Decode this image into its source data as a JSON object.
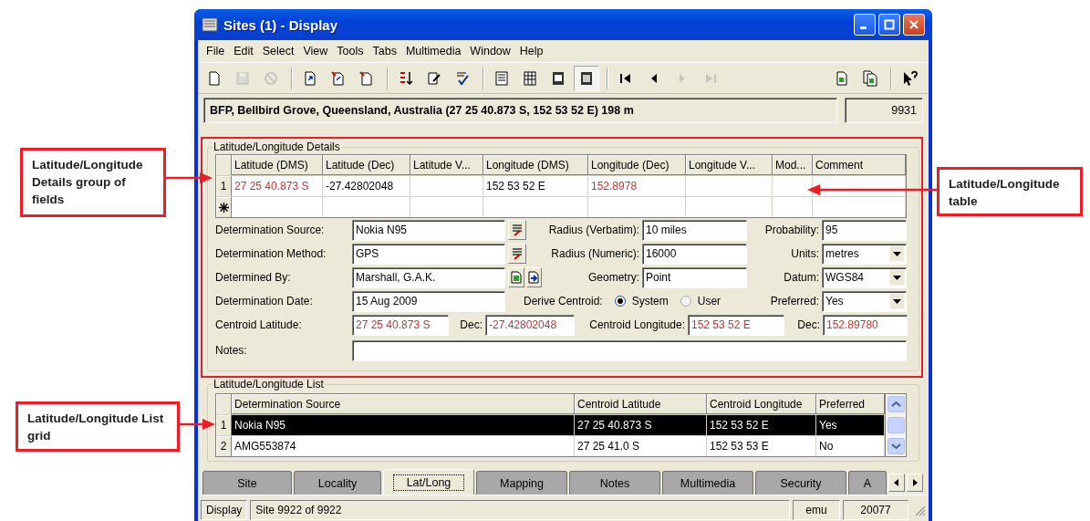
{
  "window": {
    "title": "Sites (1) - Display"
  },
  "menu": [
    "File",
    "Edit",
    "Select",
    "View",
    "Tools",
    "Tabs",
    "Multimedia",
    "Window",
    "Help"
  ],
  "toolbar": [
    {
      "disabled": false,
      "pressed": false
    },
    {
      "disabled": true,
      "pressed": false
    },
    {
      "disabled": true,
      "pressed": false
    },
    {
      "disabled": false,
      "pressed": false
    },
    {
      "disabled": false,
      "pressed": false
    },
    {
      "disabled": false,
      "pressed": false
    },
    {
      "disabled": false,
      "pressed": false
    },
    {
      "disabled": false,
      "pressed": false
    },
    {
      "disabled": false,
      "pressed": false
    },
    {
      "disabled": false,
      "pressed": false
    },
    {
      "disabled": false,
      "pressed": false
    },
    {
      "disabled": false,
      "pressed": false
    },
    {
      "disabled": false,
      "pressed": true
    },
    {
      "disabled": false,
      "pressed": false
    },
    {
      "disabled": false,
      "pressed": false
    },
    {
      "disabled": true,
      "pressed": false
    },
    {
      "disabled": true,
      "pressed": false
    },
    {
      "disabled": false,
      "pressed": false
    },
    {
      "disabled": false,
      "pressed": false
    },
    {
      "disabled": false,
      "pressed": false
    }
  ],
  "record_bar": {
    "summary": "BFP, Bellbird Grove, Queensland, Australia (27 25 40.873 S, 152 53 52 E) 198 m",
    "number": "9931"
  },
  "details": {
    "title": "Latitude/Longitude Details",
    "table": {
      "columns": [
        "Latitude (DMS)",
        "Latitude (Dec)",
        "Latitude V...",
        "Longitude (DMS)",
        "Longitude (Dec)",
        "Longitude V...",
        "Mod...",
        "Comment"
      ],
      "rows": [
        {
          "kind": "data",
          "number": "1",
          "cells": [
            {
              "text": "27 25 40.873 S",
              "color": "#c83232"
            },
            {
              "text": "-27.42802048",
              "color": "#000000"
            },
            null,
            {
              "text": "152 53 52 E",
              "color": "#000000"
            },
            {
              "text": "152.8978",
              "color": "#c83232"
            },
            null,
            null,
            null
          ]
        },
        {
          "kind": "new"
        }
      ]
    },
    "form": [
      {
        "kind": "standard",
        "items": [
          {
            "kind": "label",
            "text": "Determination Source:"
          },
          {
            "kind": "field",
            "value": "Nokia N95"
          },
          {
            "kind": "lookup"
          },
          {
            "kind": "label",
            "text": "Radius (Verbatim):"
          },
          {
            "kind": "field",
            "value": "10 miles"
          },
          {
            "kind": "label",
            "text": "Probability:"
          },
          {
            "kind": "field",
            "value": "95"
          }
        ]
      },
      {
        "kind": "standard",
        "items": [
          {
            "kind": "label",
            "text": "Determination Method:"
          },
          {
            "kind": "field",
            "value": "GPS"
          },
          {
            "kind": "lookup"
          },
          {
            "kind": "label",
            "text": "Radius (Numeric):"
          },
          {
            "kind": "field",
            "value": "16000"
          },
          {
            "kind": "label",
            "text": "Units:"
          },
          {
            "kind": "dropdown",
            "value": "metres"
          }
        ]
      },
      {
        "kind": "standard",
        "items": [
          {
            "kind": "label",
            "text": "Determined By:"
          },
          {
            "kind": "field",
            "value": "Marshall,  G.A.K."
          },
          {
            "kind": "attach-buttons"
          },
          {
            "kind": "label",
            "text": "Geometry:"
          },
          {
            "kind": "field",
            "value": "Point"
          },
          {
            "kind": "label",
            "text": "Datum:"
          },
          {
            "kind": "dropdown",
            "value": "WGS84"
          }
        ]
      },
      {
        "kind": "standard",
        "items": [
          {
            "kind": "label",
            "text": "Determination Date:"
          },
          {
            "kind": "field",
            "value": "15 Aug 2009"
          },
          {
            "kind": "radio-group",
            "label": "Derive Centroid:",
            "options": [
              {
                "label": "System",
                "selected": true
              },
              {
                "label": "User",
                "selected": false
              }
            ]
          },
          {
            "kind": "label",
            "text": "Preferred:"
          },
          {
            "kind": "dropdown",
            "value": "Yes"
          }
        ]
      },
      {
        "kind": "centroid",
        "items": [
          {
            "kind": "label",
            "text": "Centroid Latitude:"
          },
          {
            "kind": "field",
            "value": "27 25 40.873 S",
            "color": "#c83232"
          },
          {
            "kind": "label",
            "text": "Dec:"
          },
          {
            "kind": "field",
            "value": "-27.42802048",
            "color": "#c83232"
          },
          {
            "kind": "label",
            "text": "Centroid Longitude:"
          },
          {
            "kind": "field",
            "value": "152 53 52 E",
            "color": "#c83232"
          },
          {
            "kind": "label",
            "text": "Dec:"
          },
          {
            "kind": "field",
            "value": "152.89780",
            "color": "#c83232"
          }
        ]
      },
      {
        "kind": "notes",
        "items": [
          {
            "kind": "label",
            "text": "Notes:"
          },
          {
            "kind": "field"
          }
        ]
      }
    ]
  },
  "list": {
    "title": "Latitude/Longitude List",
    "columns": [
      "Determination Source",
      "Centroid Latitude",
      "Centroid Longitude",
      "Preferred"
    ],
    "rows": [
      {
        "number": "1",
        "selected": true,
        "cells": [
          "Nokia N95",
          "27 25 40.873 S",
          "152 53 52 E",
          "Yes"
        ]
      },
      {
        "number": "2",
        "selected": false,
        "cells": [
          "AMG553874",
          "27 25 41.0 S",
          "152 53 53 E",
          "No"
        ]
      }
    ]
  },
  "tabs": [
    {
      "label": "Site",
      "selected": false
    },
    {
      "label": "Locality",
      "selected": false
    },
    {
      "label": "Lat/Long",
      "selected": true
    },
    {
      "label": "Mapping",
      "selected": false
    },
    {
      "label": "Notes",
      "selected": false
    },
    {
      "label": "Multimedia",
      "selected": false
    },
    {
      "label": "Security",
      "selected": false
    },
    {
      "label": "A",
      "selected": false
    }
  ],
  "status_bar": [
    "Display",
    "Site 9922 of 9922",
    "emu",
    "20077"
  ],
  "annotations": [
    {
      "text": "Latitude/Longitude Details group of fields"
    },
    {
      "text": "Latitude/Longitude table"
    },
    {
      "text": "Latitude/Longitude List grid"
    }
  ]
}
